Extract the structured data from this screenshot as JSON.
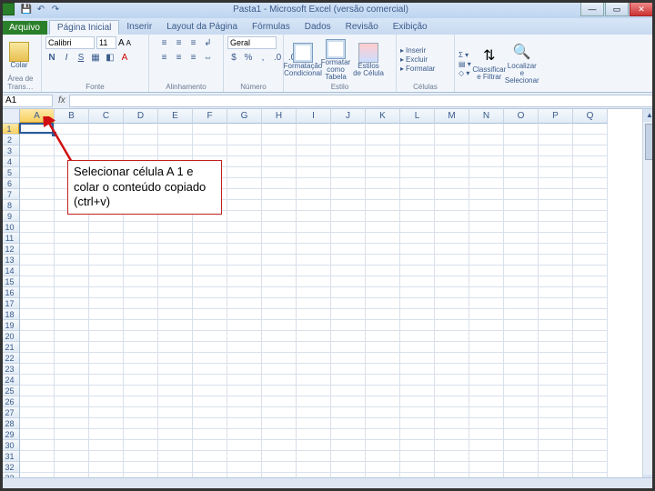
{
  "window": {
    "title": "Pasta1 - Microsoft Excel (versão comercial)"
  },
  "tabs": {
    "file": "Arquivo",
    "items": [
      "Página Inicial",
      "Inserir",
      "Layout da Página",
      "Fórmulas",
      "Dados",
      "Revisão",
      "Exibição"
    ],
    "active_index": 0
  },
  "ribbon": {
    "clipboard": {
      "paste": "Colar",
      "group": "Área de Trans…"
    },
    "font": {
      "name": "Calibri",
      "size": "11",
      "group": "Fonte"
    },
    "alignment": {
      "group": "Alinhamento"
    },
    "number": {
      "format": "Geral",
      "group": "Número"
    },
    "styles": {
      "cond": "Formatação Condicional",
      "table": "Formatar como Tabela",
      "cell": "Estilos de Célula",
      "group": "Estilo"
    },
    "cells": {
      "insert": "Inserir",
      "delete": "Excluir",
      "format": "Formatar",
      "group": "Células"
    },
    "editing": {
      "sort": "Classificar e Filtrar",
      "find": "Localizar e Selecionar"
    }
  },
  "namebox": "A1",
  "columns": [
    "A",
    "B",
    "C",
    "D",
    "E",
    "F",
    "G",
    "H",
    "I",
    "J",
    "K",
    "L",
    "M",
    "N",
    "O",
    "P",
    "Q"
  ],
  "rows": 34,
  "selected": {
    "col": "A",
    "row": 1
  },
  "annotation": {
    "text": "Selecionar célula A 1 e colar o conteúdo copiado (ctrl+v)"
  }
}
